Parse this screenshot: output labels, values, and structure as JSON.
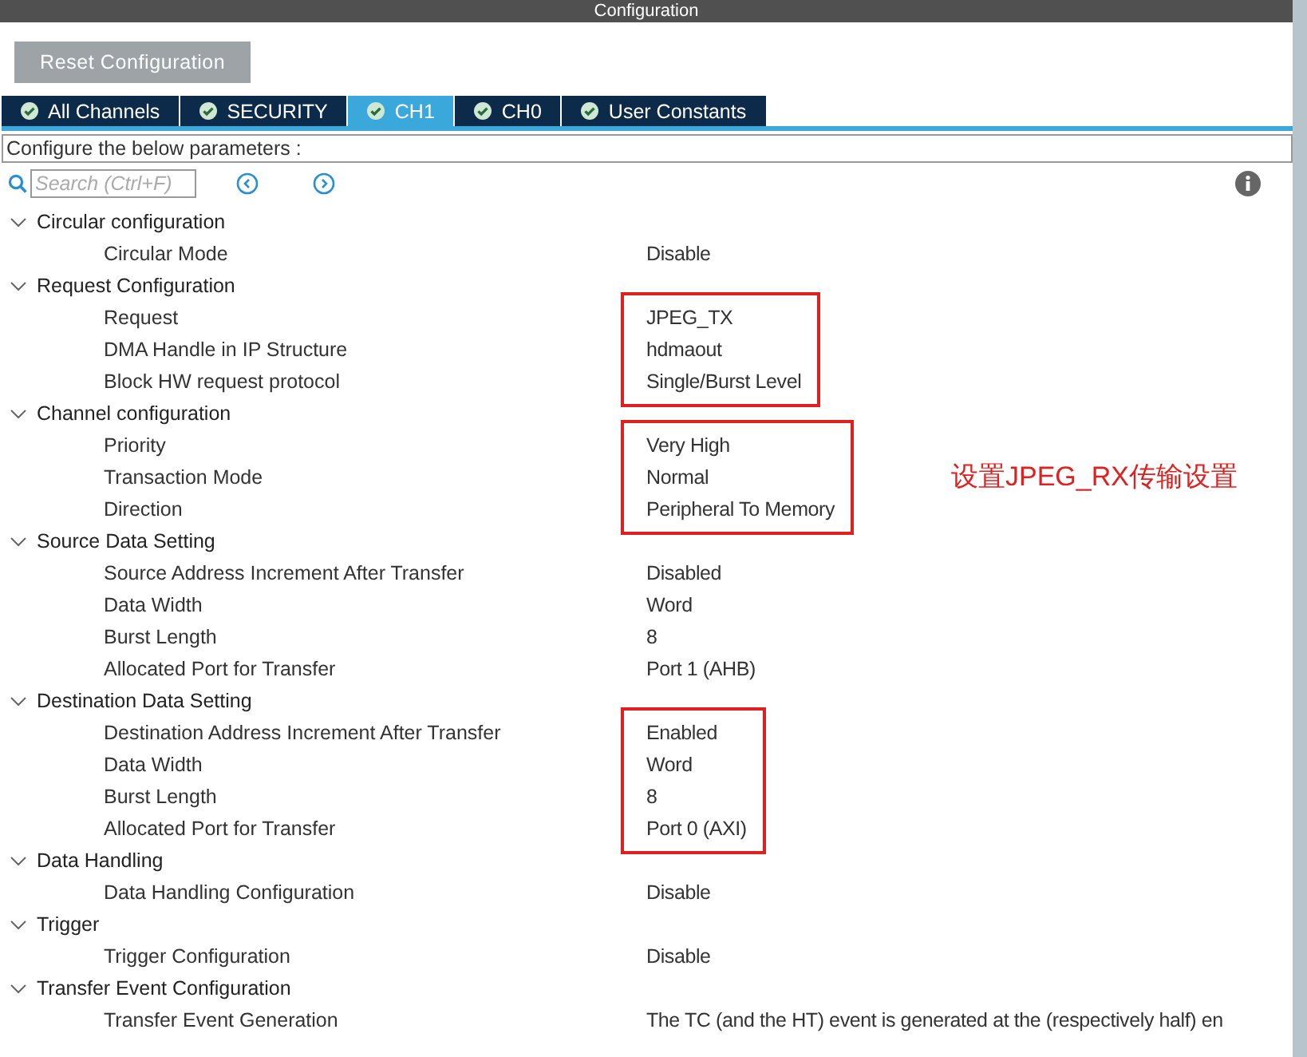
{
  "window": {
    "title": "Configuration"
  },
  "reset_button": "Reset Configuration",
  "tabs": [
    {
      "label": "All Channels",
      "selected": false
    },
    {
      "label": "SECURITY",
      "selected": false
    },
    {
      "label": "CH1",
      "selected": true
    },
    {
      "label": "CH0",
      "selected": false
    },
    {
      "label": "User Constants",
      "selected": false
    }
  ],
  "description": "Configure the below parameters :",
  "search": {
    "placeholder": "Search (Ctrl+F)"
  },
  "groups": [
    {
      "label": "Circular configuration",
      "expanded": true,
      "params": [
        {
          "name": "Circular Mode",
          "value": "Disable",
          "highlighted": false
        }
      ]
    },
    {
      "label": "Request Configuration",
      "expanded": true,
      "params": [
        {
          "name": "Request",
          "value": "JPEG_TX",
          "highlighted": true
        },
        {
          "name": "DMA Handle in IP Structure",
          "value": "hdmaout",
          "highlighted": true
        },
        {
          "name": "Block HW request protocol",
          "value": "Single/Burst Level",
          "highlighted": true
        }
      ]
    },
    {
      "label": "Channel configuration",
      "expanded": true,
      "note": "设置JPEG_RX传输设置",
      "params": [
        {
          "name": "Priority",
          "value": "Very High",
          "highlighted": true
        },
        {
          "name": "Transaction Mode",
          "value": "Normal",
          "highlighted": true
        },
        {
          "name": "Direction",
          "value": "Peripheral To Memory",
          "highlighted": true
        }
      ]
    },
    {
      "label": "Source Data Setting",
      "expanded": true,
      "params": [
        {
          "name": "Source Address Increment After Transfer",
          "value": "Disabled",
          "highlighted": false
        },
        {
          "name": "Data Width",
          "value": "Word",
          "highlighted": false
        },
        {
          "name": "Burst Length",
          "value": "8",
          "highlighted": false
        },
        {
          "name": "Allocated Port for Transfer",
          "value": "Port 1 (AHB)",
          "highlighted": false
        }
      ]
    },
    {
      "label": "Destination Data Setting",
      "expanded": true,
      "params": [
        {
          "name": "Destination Address Increment After Transfer",
          "value": "Enabled",
          "highlighted": true
        },
        {
          "name": "Data Width",
          "value": "Word",
          "highlighted": true
        },
        {
          "name": "Burst Length",
          "value": "8",
          "highlighted": true
        },
        {
          "name": "Allocated Port for Transfer",
          "value": "Port 0 (AXI)",
          "highlighted": true
        }
      ]
    },
    {
      "label": "Data Handling",
      "expanded": true,
      "params": [
        {
          "name": "Data Handling Configuration",
          "value": "Disable",
          "highlighted": false
        }
      ]
    },
    {
      "label": "Trigger",
      "expanded": true,
      "params": [
        {
          "name": "Trigger Configuration",
          "value": "Disable",
          "highlighted": false
        }
      ]
    },
    {
      "label": "Transfer Event Configuration",
      "expanded": true,
      "params": [
        {
          "name": "Transfer Event Generation",
          "value": "The TC (and the HT) event is generated at the (respectively half) en",
          "highlighted": false
        }
      ]
    }
  ]
}
